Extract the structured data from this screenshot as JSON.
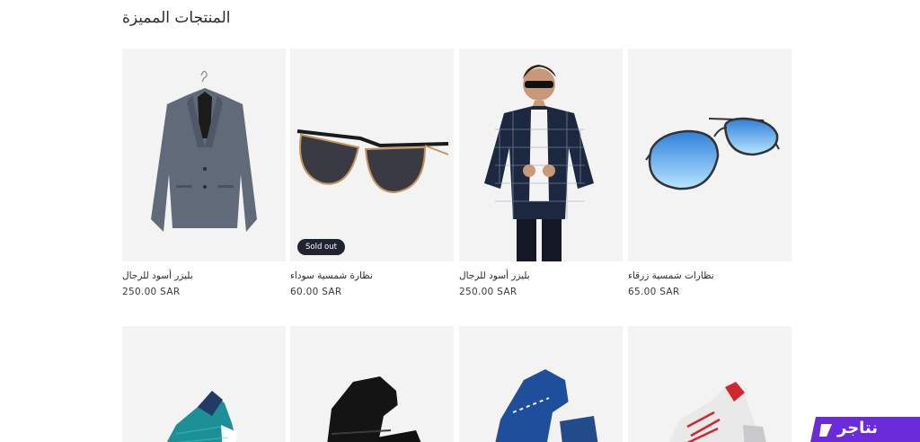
{
  "section": {
    "title": "المنتجات المميزة"
  },
  "products_row1": [
    {
      "title": "بليزر أسود للرجال",
      "price": "250.00 SAR",
      "badge": ""
    },
    {
      "title": "نظارة شمسية سوداء",
      "price": "60.00 SAR",
      "badge": "Sold out"
    },
    {
      "title": "بليزر أسود للرجال",
      "price": "250.00 SAR",
      "badge": ""
    },
    {
      "title": "نظارات شمسية زرقاء",
      "price": "65.00 SAR",
      "badge": ""
    }
  ],
  "brand": {
    "name": "نتاجر",
    "color": "#6b2bd9"
  },
  "colors": {
    "card_bg": "#f3f3f3",
    "badge_bg": "#1f2430"
  },
  "icons": [
    "blazer-image",
    "sunglasses-image",
    "model-image",
    "aviator-image",
    "sneaker-image"
  ]
}
